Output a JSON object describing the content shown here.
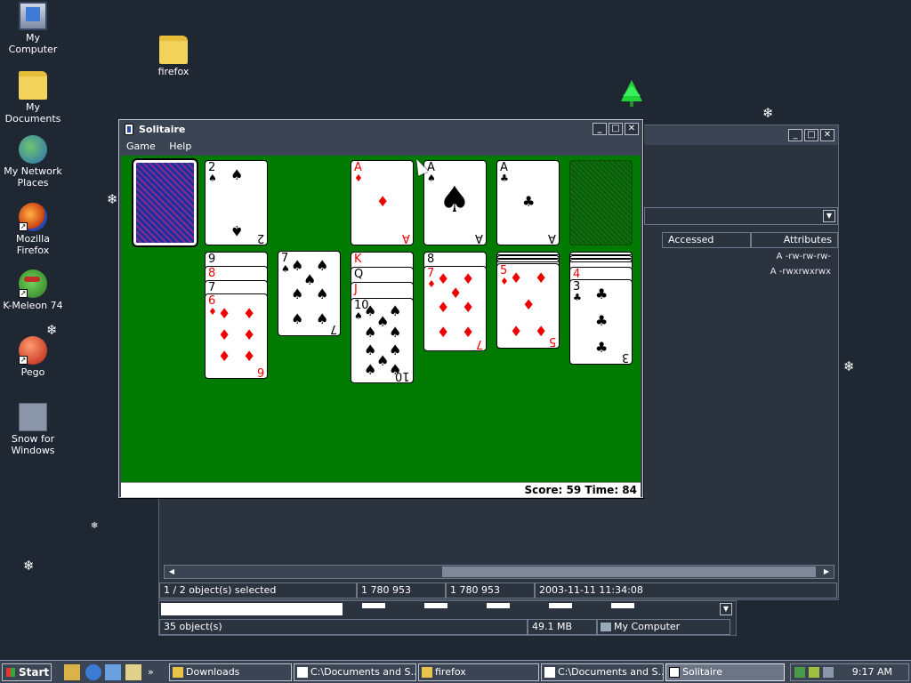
{
  "desktop": {
    "icons": [
      {
        "label": "My Computer"
      },
      {
        "label": "My Documents"
      },
      {
        "label": "My Network Places"
      },
      {
        "label": "Mozilla Firefox"
      },
      {
        "label": "K-Meleon 74"
      },
      {
        "label": "Pego"
      },
      {
        "label": "Snow for Windows"
      },
      {
        "label": "firefox"
      }
    ]
  },
  "explorer": {
    "columns": [
      "Accessed",
      "Attributes"
    ],
    "rows": [
      "A -rw-rw-rw-",
      "A -rwxrwxrwx"
    ],
    "status": [
      "1 / 2 object(s) selected",
      "1 780 953",
      "1 780 953",
      "2003-11-11 11:34:08"
    ]
  },
  "window2": {
    "status": [
      "35 object(s)",
      "49.1 MB",
      "My Computer"
    ]
  },
  "solitaire": {
    "title": "Solitaire",
    "menu": [
      "Game",
      "Help"
    ],
    "status": "Score: 59 Time: 84",
    "colors": {
      "felt": "#007a00",
      "card_red": "#ee0000"
    }
  },
  "taskbar": {
    "start": "Start",
    "tasks": [
      "Downloads",
      "C:\\Documents and S...",
      "firefox",
      "C:\\Documents and S...",
      "Solitaire"
    ],
    "clock": "9:17 AM"
  }
}
